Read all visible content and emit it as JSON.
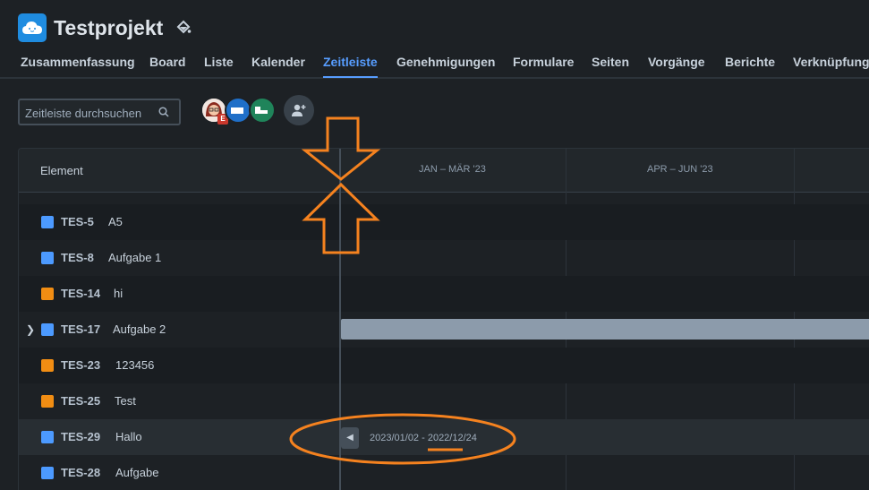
{
  "project": {
    "title": "Testprojekt",
    "icon": "cloud-icon",
    "accent": "#1f8ce0"
  },
  "tabs": [
    {
      "label": "Zusammenfassung"
    },
    {
      "label": "Board"
    },
    {
      "label": "Liste"
    },
    {
      "label": "Kalender"
    },
    {
      "label": "Zeitleiste",
      "active": true
    },
    {
      "label": "Genehmigungen"
    },
    {
      "label": "Formulare"
    },
    {
      "label": "Seiten"
    },
    {
      "label": "Vorgänge"
    },
    {
      "label": "Berichte"
    },
    {
      "label": "Verknüpfunge"
    }
  ],
  "search": {
    "placeholder": "Zeitleiste durchsuchen",
    "value": ""
  },
  "avatars": {
    "first_badge": "E"
  },
  "timeline": {
    "element_header": "Element",
    "months": [
      "JAN – MÄR '23",
      "APR – JUN '23"
    ],
    "rows": [
      {
        "key": "TES-5",
        "summary": "A5",
        "type": "task"
      },
      {
        "key": "TES-8",
        "summary": "Aufgabe 1",
        "type": "task"
      },
      {
        "key": "TES-14",
        "summary": "hi",
        "type": "idea"
      },
      {
        "key": "TES-17",
        "summary": "Aufgabe 2",
        "type": "task",
        "expandable": true
      },
      {
        "key": "TES-23",
        "summary": "123456",
        "type": "idea"
      },
      {
        "key": "TES-25",
        "summary": "Test",
        "type": "idea"
      },
      {
        "key": "TES-29",
        "summary": "Hallo",
        "type": "task",
        "selected": true
      },
      {
        "key": "TES-28",
        "summary": "Aufgabe",
        "type": "task"
      }
    ],
    "date_range": "2023/01/02 - 2022/12/24"
  },
  "colors": {
    "active_tab": "#579dff",
    "annotation": "#f5821f",
    "bar": "#8c9bab"
  }
}
